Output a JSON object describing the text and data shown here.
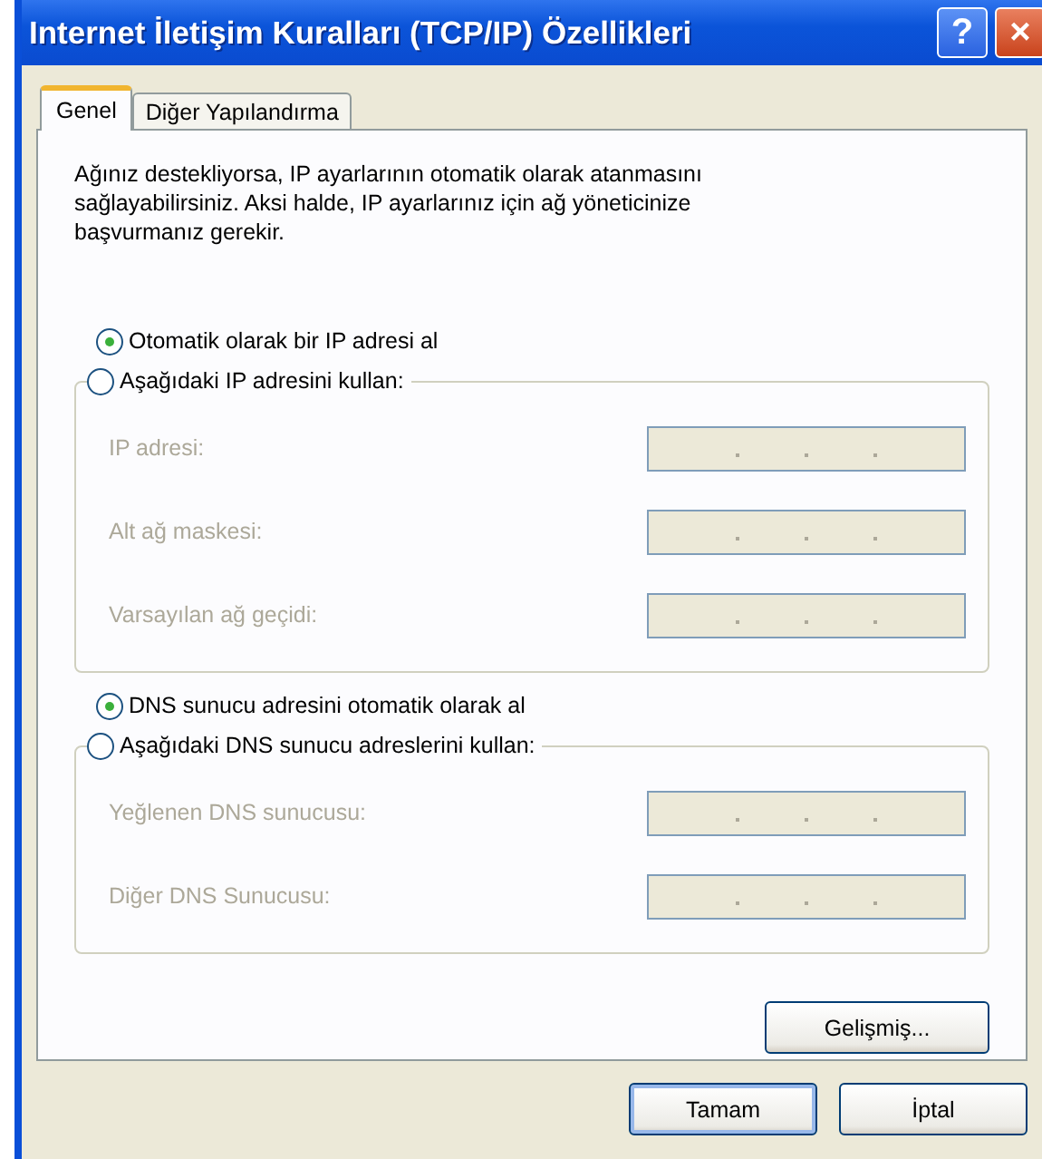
{
  "window": {
    "title": "Internet İletişim Kuralları (TCP/IP) Özellikleri",
    "help_button": "?",
    "close_button": "×"
  },
  "tabs": [
    {
      "label": "Genel",
      "selected": true
    },
    {
      "label": "Diğer Yapılandırma",
      "selected": false
    }
  ],
  "description": "Ağınız destekliyorsa, IP ayarlarının otomatik olarak atanmasını sağlayabilirsiniz. Aksi halde, IP ayarlarınız için ağ yöneticinize başvurmanız gerekir.",
  "sections": [
    {
      "auto_option": {
        "label": "Otomatik olarak bir IP adresi al",
        "selected": true
      },
      "manual_option": {
        "label": "Aşağıdaki IP adresini kullan:",
        "selected": false
      },
      "fields": [
        {
          "label": "IP adresi:",
          "disabled": true
        },
        {
          "label": "Alt ağ maskesi:",
          "disabled": true
        },
        {
          "label": "Varsayılan ağ geçidi:",
          "disabled": true
        }
      ]
    },
    {
      "auto_option": {
        "label": "DNS sunucu adresini otomatik olarak al",
        "selected": true
      },
      "manual_option": {
        "label": "Aşağıdaki DNS sunucu adreslerini kullan:",
        "selected": false
      },
      "fields": [
        {
          "label": "Yeğlenen DNS sunucusu:",
          "disabled": true
        },
        {
          "label": "Diğer DNS Sunucusu:",
          "disabled": true
        }
      ]
    }
  ],
  "advanced_button": "Gelişmiş...",
  "buttons": [
    {
      "label": "Tamam",
      "default": true
    },
    {
      "label": "İptal",
      "default": false
    }
  ]
}
